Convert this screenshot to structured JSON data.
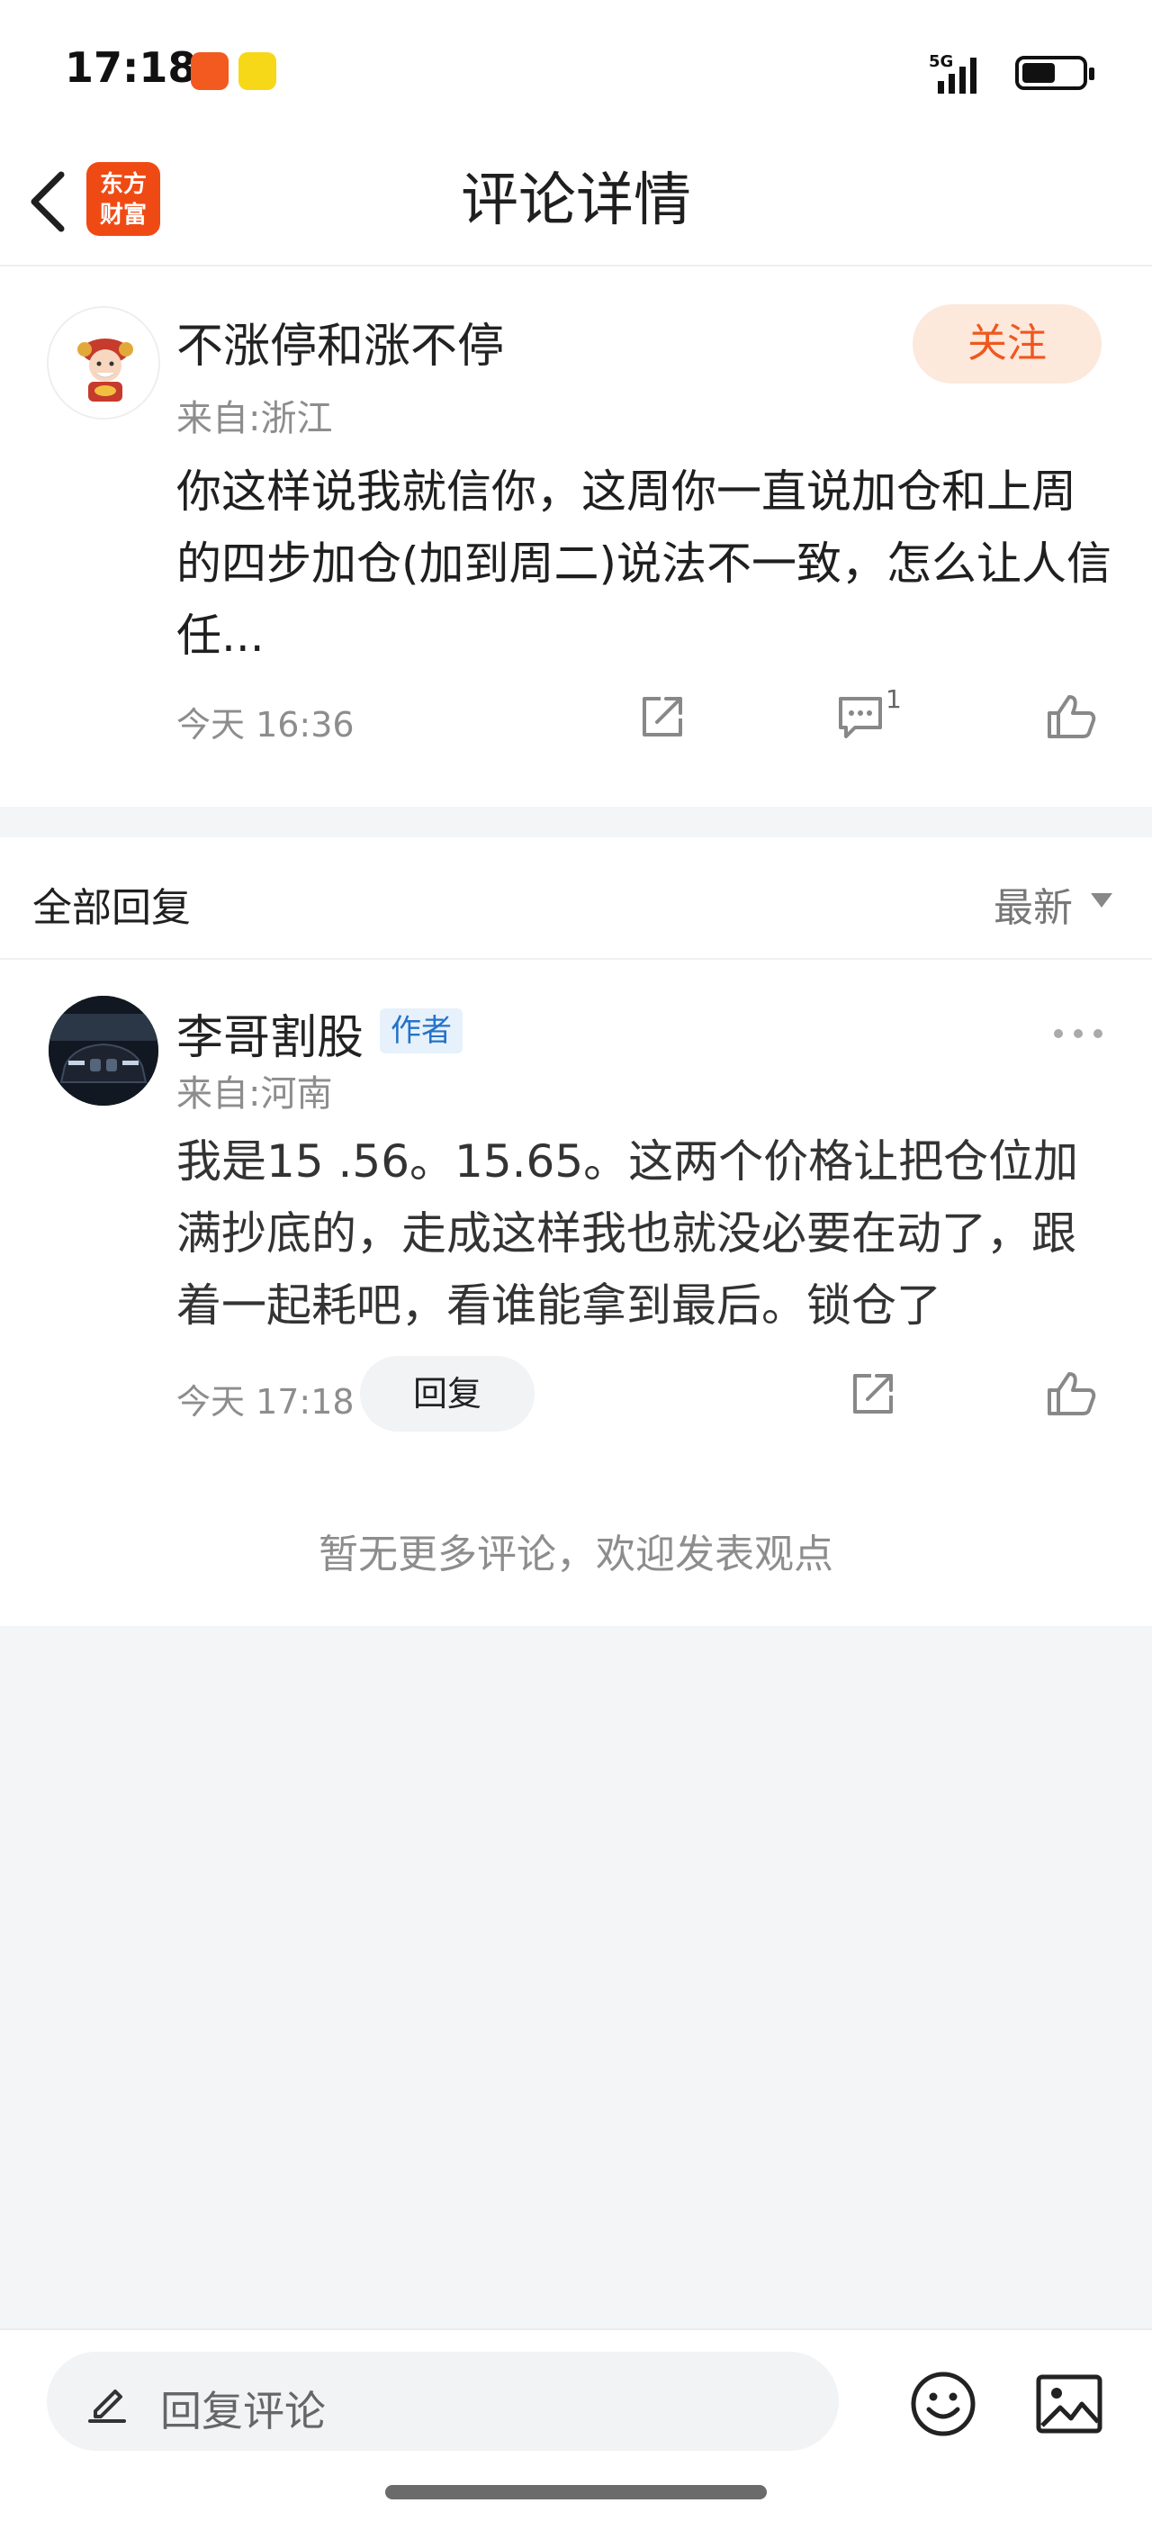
{
  "status_bar": {
    "time": "17:18",
    "network": "5G"
  },
  "nav": {
    "title": "评论详情",
    "logo_text_line1": "东方",
    "logo_text_line2": "财富"
  },
  "post": {
    "username": "不涨停和涨不停",
    "location": "来自:浙江",
    "follow_label": "关注",
    "content": "你这样说我就信你，这周你一直说加仓和上周的四步加仓(加到周二)说法不一致，怎么让人信任...",
    "time": "今天 16:36",
    "comment_count": "1"
  },
  "replies_section": {
    "label": "全部回复",
    "sort_label": "最新"
  },
  "reply": {
    "username": "李哥割股",
    "author_tag": "作者",
    "location": "来自:河南",
    "content": "我是15 .56。15.65。这两个价格让把仓位加满抄底的，走成这样我也就没必要在动了，跟着一起耗吧，看谁能拿到最后。锁仓了",
    "time": "今天 17:18",
    "reply_label": "回复"
  },
  "footer_note": "暂无更多评论，欢迎发表观点",
  "bottom_bar": {
    "input_placeholder": "回复评论"
  },
  "colors": {
    "accent": "#f0571e",
    "follow_bg": "#fde8dc",
    "tag_blue": "#2473c8",
    "page_grey": "#f4f5f7"
  }
}
